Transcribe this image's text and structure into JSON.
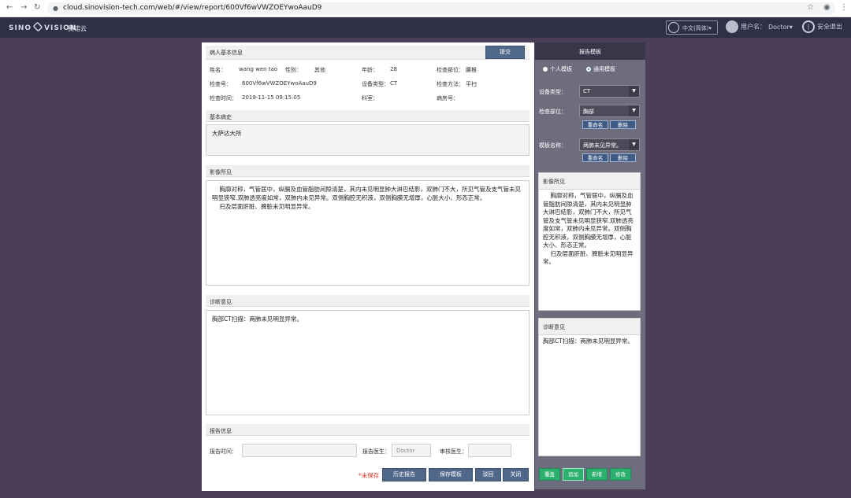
{
  "browser": {
    "back_icon": "arrow-left-icon",
    "forward_icon": "arrow-right-icon",
    "reload_icon": "reload-icon",
    "url": "cloud.sinovision-tech.com/web/#/view/report/600Vf6wVWZOEYwoAauD9"
  },
  "header": {
    "logo_left": "SINO",
    "logo_right": "VISION",
    "app_name": "赛诺云",
    "language": "中文(简体)▾",
    "user_label": "用户名：",
    "user_name": "Doctor▾",
    "logout": "安全退出"
  },
  "patient": {
    "section_title": "病人基本信息",
    "submit_button": "提交",
    "name_label": "姓名：",
    "name_value": "wang wen tao",
    "sex_label": "性别：",
    "sex_value": "其他",
    "age_label": "年龄：",
    "age_value": "28",
    "part_label": "检查部位：",
    "part_value": "腰椎",
    "exam_no_label": "检查号：",
    "exam_no_value": "600Vf6wVWZOEYwoAauD9",
    "device_label": "设备类型：",
    "device_value": "CT",
    "method_label": "检查方法：",
    "method_value": "平扫",
    "time_label": "检查时间：",
    "time_value": "2019-11-15 09:15:05",
    "ward_label": "科室：",
    "ward_value": "",
    "case_label": "病房号：",
    "case_value": ""
  },
  "history": {
    "title": "基本病史",
    "text": "大萨达大所"
  },
  "findings": {
    "title": "影像所见",
    "text": "    胸廓对称，气管居中，纵膈及血管脂肪间隙清楚，其内未见明显肿大淋巴结影，双肺门不大，所见气管及支气管未见明显狭窄.双肺透亮度如常，双肺内未见异常。双侧胸腔无积液，双侧胸膜无增厚，心脏大小、形态正常。\n    扫及层面肝脏、脾脏未见明显异常。"
  },
  "diagnosis": {
    "title": "诊断意见",
    "text": "胸部CT扫描：两肺未见明显异常。"
  },
  "report_info": {
    "title": "报告信息",
    "time_label": "报告时间：",
    "time_value": "",
    "doctor_label": "报告医生：",
    "doctor_value": "Doctor",
    "reviewer_label": "审核医生：",
    "reviewer_value": ""
  },
  "footer": {
    "unsaved": "*未保存",
    "history_button": "历史报告",
    "save_template_button": "保存模板",
    "return_button": "驳回",
    "close_button": "关闭"
  },
  "template": {
    "title": "报告模板",
    "personal_label": "个人模板",
    "common_label": "通用模板",
    "common_selected": true,
    "device_label": "设备类型：",
    "device_value": "CT",
    "part_label": "检查部位：",
    "part_value": "胸部",
    "rename_button": "重命名",
    "delete_button": "删除",
    "name_label": "模板名称：",
    "name_value": "两肺未见异常。",
    "rename_button_2": "重命名",
    "delete_button_2": "删除",
    "findings_title": "影像所见",
    "findings_text": "    胸廓对称，气管居中，纵膈及血管脂肪间隙清楚，其内未见明显肿大淋巴结影，双肺门不大，所见气管及支气管未见明显狭窄.双肺透亮度如常，双肺内未见异常。双侧胸腔无积液，双侧胸膜无增厚，心脏大小、形态正常。\n    扫及层面肝脏、脾脏未见明显异常。",
    "diagnosis_title": "诊断意见",
    "diagnosis_text": "胸部CT扫描：两肺未见明显异常。",
    "btn_cover": "覆盖",
    "btn_append": "追加",
    "btn_new": "新增",
    "btn_edit": "修改"
  },
  "colors": {
    "page_bg": "#4a3f57",
    "header_bg": "#2f2f45",
    "panel_bg": "#6d6d7e",
    "button_blue": "#4f6788",
    "button_green": "#2bb06f",
    "unsaved_red": "#e0302a"
  }
}
